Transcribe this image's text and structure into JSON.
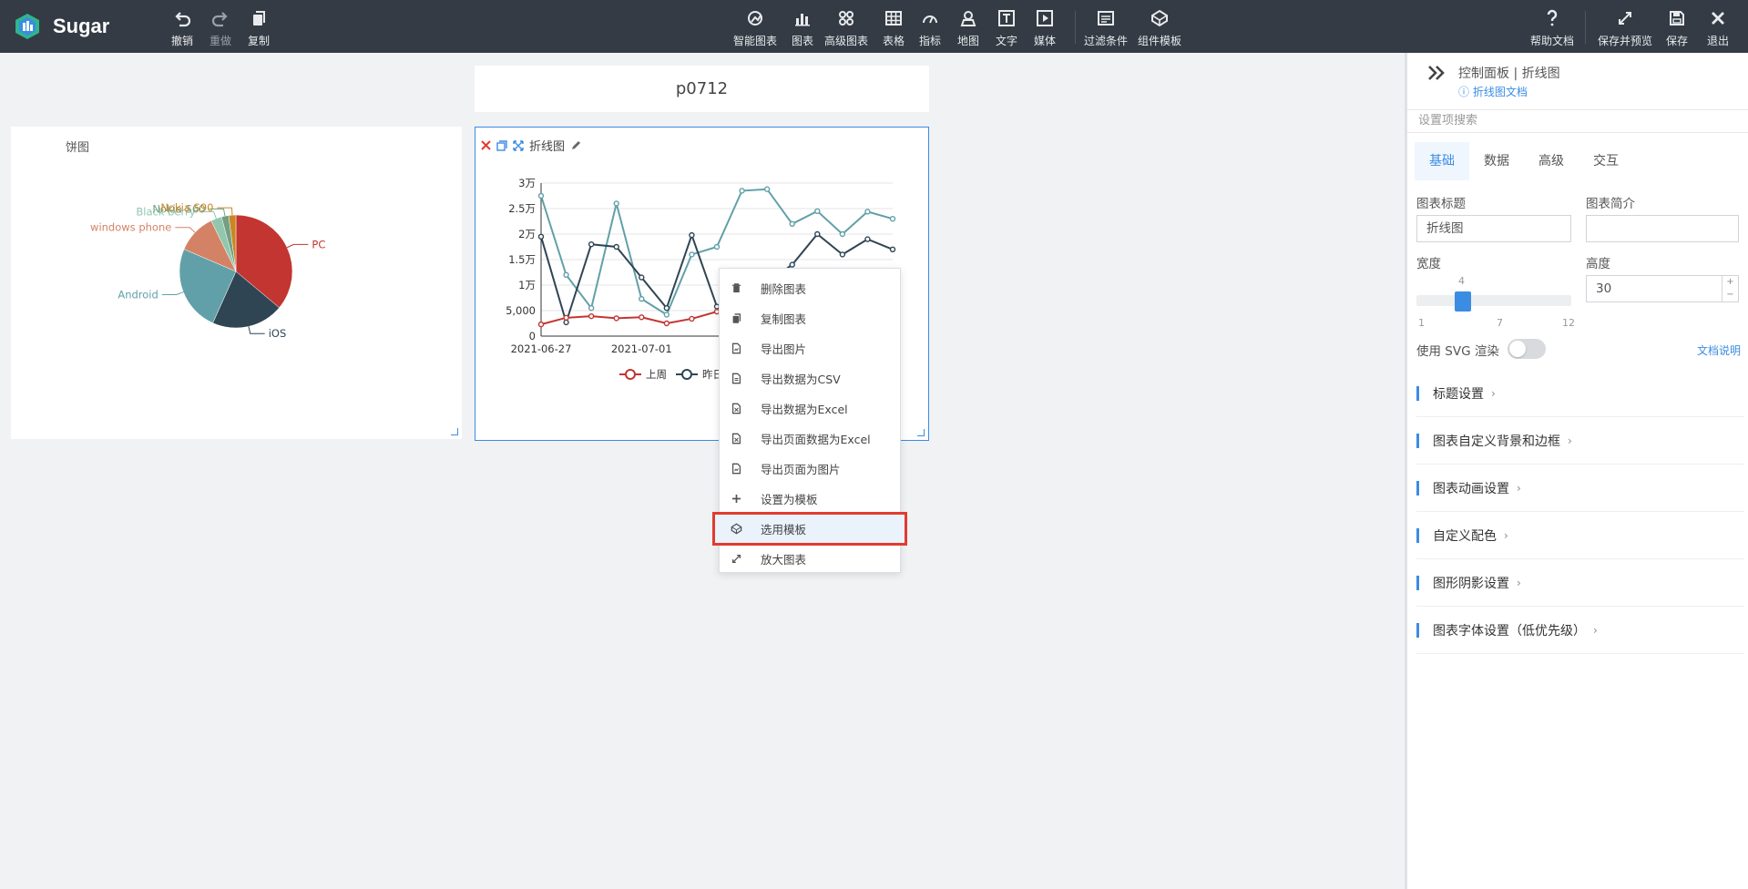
{
  "app": {
    "name": "Sugar"
  },
  "toolbar_left": [
    {
      "label": "撤销",
      "icon": "undo-icon"
    },
    {
      "label": "重做",
      "icon": "redo-icon"
    },
    {
      "label": "复制",
      "icon": "copy-icon"
    }
  ],
  "toolbar_center": [
    {
      "label": "智能图表",
      "icon": "smart-chart-icon"
    },
    {
      "label": "图表",
      "icon": "bar-chart-icon"
    },
    {
      "label": "高级图表",
      "icon": "advanced-chart-icon"
    },
    {
      "label": "表格",
      "icon": "table-icon"
    },
    {
      "label": "指标",
      "icon": "gauge-icon"
    },
    {
      "label": "地图",
      "icon": "map-pin-icon"
    },
    {
      "label": "文字",
      "icon": "text-icon"
    },
    {
      "label": "媒体",
      "icon": "media-icon"
    },
    {
      "label": "过滤条件",
      "icon": "filter-icon"
    },
    {
      "label": "组件模板",
      "icon": "template-icon"
    }
  ],
  "toolbar_right": [
    {
      "label": "帮助文档",
      "icon": "help-icon"
    },
    {
      "label": "保存并预览",
      "icon": "expand-icon"
    },
    {
      "label": "保存",
      "icon": "save-icon"
    },
    {
      "label": "退出",
      "icon": "close-icon"
    }
  ],
  "page": {
    "title": "p0712"
  },
  "pie_card": {
    "title": "饼图"
  },
  "line_card": {
    "title": "折线图",
    "legend": [
      "上周",
      "昨日"
    ]
  },
  "context_menu": [
    {
      "label": "删除图表",
      "icon": "trash-icon"
    },
    {
      "label": "复制图表",
      "icon": "copy-icon"
    },
    {
      "label": "导出图片",
      "icon": "image-file-icon"
    },
    {
      "label": "导出数据为CSV",
      "icon": "csv-file-icon"
    },
    {
      "label": "导出数据为Excel",
      "icon": "excel-file-icon"
    },
    {
      "label": "导出页面数据为Excel",
      "icon": "excel-file-icon"
    },
    {
      "label": "导出页面为图片",
      "icon": "image-file-icon"
    },
    {
      "label": "设置为模板",
      "icon": "plus-icon"
    },
    {
      "label": "选用模板",
      "icon": "template-icon",
      "highlighted": true
    },
    {
      "label": "放大图表",
      "icon": "expand-icon"
    }
  ],
  "panel": {
    "header": "控制面板 | 折线图",
    "doc_link": "折线图文档",
    "search_placeholder": "设置项搜索",
    "tabs": [
      "基础",
      "数据",
      "高级",
      "交互"
    ],
    "active_tab": "基础",
    "chart_title_label": "图表标题",
    "chart_title_value": "折线图",
    "chart_intro_label": "图表简介",
    "chart_intro_value": "",
    "width_label": "宽度",
    "width_value": "4",
    "width_min": "1",
    "width_mid": "7",
    "width_max": "12",
    "height_label": "高度",
    "height_value": "30",
    "svg_label": "使用 SVG 渲染",
    "svg_enabled": false,
    "doc_note": "文档说明",
    "sections": [
      "标题设置",
      "图表自定义背景和边框",
      "图表动画设置",
      "自定义配色",
      "图形阴影设置",
      "图表字体设置（低优先级）"
    ]
  },
  "chart_data": [
    {
      "type": "pie",
      "title": "饼图",
      "categories": [
        "PC",
        "iOS",
        "Android",
        "windows phone",
        "Black berry",
        "Nokia S60",
        "Nokia S90"
      ],
      "values": [
        35,
        20,
        24,
        11,
        3,
        2,
        2
      ],
      "colors": [
        "#c23531",
        "#2f4554",
        "#61a0a8",
        "#d48265",
        "#91c7ae",
        "#749f83",
        "#ca8622"
      ]
    },
    {
      "type": "line",
      "title": "折线图",
      "x": [
        "2021-06-27",
        "2021-06-28",
        "2021-06-29",
        "2021-06-30",
        "2021-07-01",
        "2021-07-02",
        "2021-07-03",
        "2021-07-04",
        "2021-07-05",
        "2021-07-06",
        "2021-07-07",
        "2021-07-08",
        "2021-07-09",
        "2021-07-10",
        "2021-07-11"
      ],
      "x_ticks": [
        "2021-06-27",
        "2021-07-01"
      ],
      "y_ticks": [
        "0",
        "5,000",
        "1万",
        "1.5万",
        "2万",
        "2.5万",
        "3万"
      ],
      "ylim": [
        0,
        30000
      ],
      "series": [
        {
          "name": "上周",
          "color": "#c23531",
          "values": [
            2300,
            3600,
            3900,
            3500,
            3700,
            2500,
            3400,
            4800,
            5200,
            5000,
            4700,
            4900,
            5000,
            5100,
            4900
          ]
        },
        {
          "name": "昨日",
          "color": "#2f4554",
          "values": [
            19500,
            2700,
            18000,
            17500,
            11500,
            5500,
            19800,
            5800,
            9000,
            10500,
            14000,
            20000,
            16000,
            19000,
            17000
          ]
        },
        {
          "name": "",
          "color": "#61a0a8",
          "values": [
            27500,
            12000,
            5500,
            26000,
            7300,
            4200,
            16000,
            17500,
            28500,
            28800,
            22000,
            24500,
            20000,
            24400,
            23000
          ]
        }
      ]
    }
  ]
}
